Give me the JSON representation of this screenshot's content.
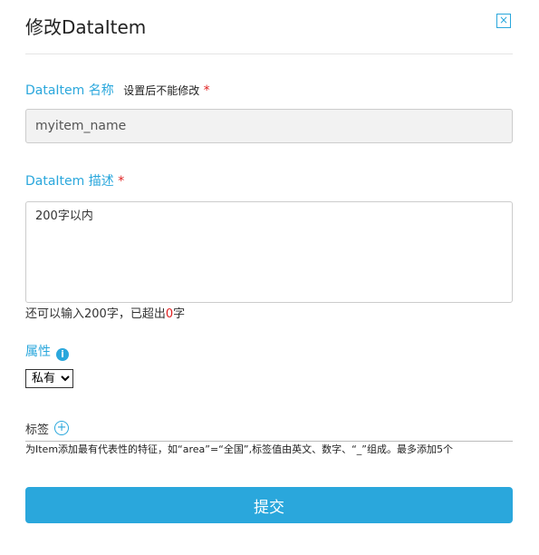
{
  "dialog": {
    "title": "修改DataItem",
    "close_label": "×"
  },
  "name_field": {
    "label": "DataItem 名称",
    "hint": "设置后不能修改",
    "required_mark": "*",
    "value": "myitem_name"
  },
  "desc_field": {
    "label": "DataItem 描述",
    "required_mark": "*",
    "placeholder": "200字以内",
    "counter_prefix": "还可以输入",
    "counter_remaining": "200",
    "counter_mid": "字，已超出",
    "counter_exceeded": "0",
    "counter_suffix": "字"
  },
  "visibility": {
    "label": "属性",
    "info_icon": "i",
    "selected": "私有"
  },
  "tags": {
    "label": "标签",
    "add_icon": "+",
    "help": "为Item添加最有代表性的特征，如“area”=“全国”,标签值由英文、数字、“_”组成。最多添加5个"
  },
  "submit_label": "提交",
  "colors": {
    "accent": "#2aa7dc",
    "required": "#e02020"
  }
}
